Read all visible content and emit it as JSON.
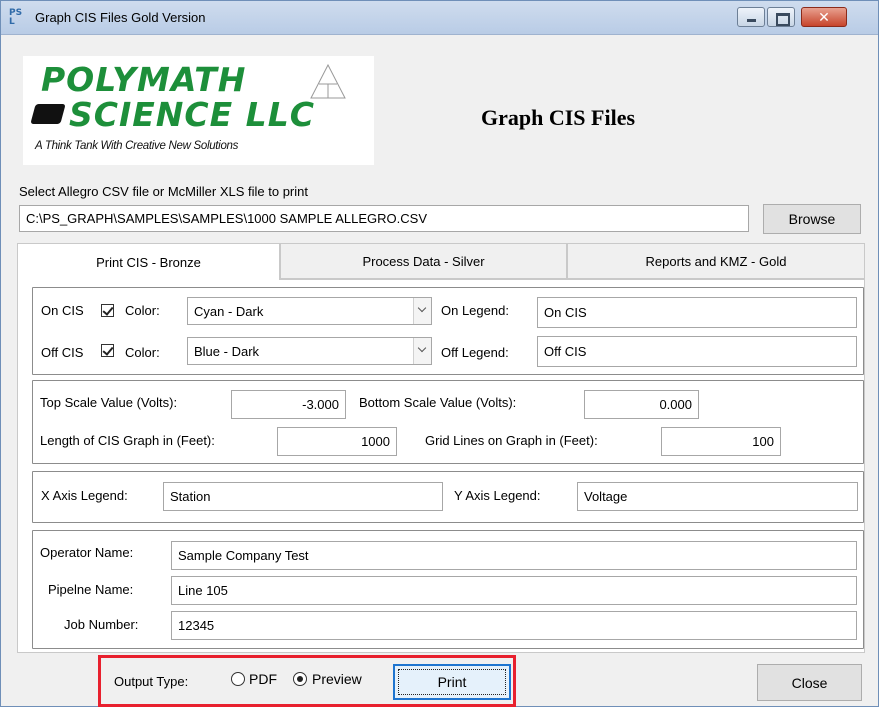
{
  "window": {
    "icon_text": "PS L",
    "title": "Graph CIS Files Gold Version"
  },
  "logo": {
    "line1": "POLYMATH",
    "line2": "SCIENCE LLC",
    "tagline": "A Think Tank With Creative New Solutions"
  },
  "header": {
    "title": "Graph CIS Files"
  },
  "file": {
    "label": "Select Allegro CSV file or McMiller XLS file to print",
    "path": "C:\\PS_GRAPH\\SAMPLES\\SAMPLES\\1000 SAMPLE ALLEGRO.CSV",
    "browse_label": "Browse"
  },
  "tabs": [
    {
      "label": "Print CIS - Bronze",
      "active": true
    },
    {
      "label": "Process Data - Silver",
      "active": false
    },
    {
      "label": "Reports and KMZ - Gold",
      "active": false
    }
  ],
  "cis": {
    "on_label": "On CIS",
    "on_checked": true,
    "color_label": "Color:",
    "on_color": "Cyan - Dark",
    "on_legend_label": "On Legend:",
    "on_legend": "On CIS",
    "off_label": "Off CIS",
    "off_checked": true,
    "off_color": "Blue - Dark",
    "off_legend_label": "Off Legend:",
    "off_legend": "Off CIS"
  },
  "scale": {
    "top_label": "Top Scale Value (Volts):",
    "top_value": "-3.000",
    "bottom_label": "Bottom Scale Value (Volts):",
    "bottom_value": "0.000",
    "length_label": "Length of CIS Graph in (Feet):",
    "length_value": "1000",
    "grid_label": "Grid Lines on Graph in (Feet):",
    "grid_value": "100"
  },
  "axes": {
    "x_label": "X Axis Legend:",
    "x_value": "Station",
    "y_label": "Y Axis Legend:",
    "y_value": "Voltage"
  },
  "info": {
    "operator_label": "Operator Name:",
    "operator_value": "Sample Company Test",
    "pipeline_label": "Pipelne Name:",
    "pipeline_value": "Line 105",
    "job_label": "Job Number:",
    "job_value": "12345"
  },
  "output": {
    "label": "Output Type:",
    "pdf_label": "PDF",
    "preview_label": "Preview",
    "selected": "Preview",
    "print_label": "Print",
    "close_label": "Close"
  },
  "colors": {
    "highlight_border": "#e8202e",
    "focus_border": "#1e75d0",
    "logo_green": "#1d8f3a"
  }
}
